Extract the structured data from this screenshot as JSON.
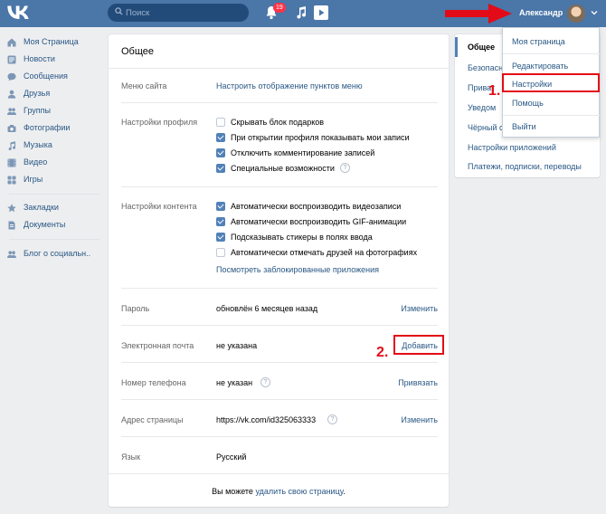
{
  "header": {
    "logo": "VK",
    "search_placeholder": "Поиск",
    "notification_count": "19",
    "user_name": "Александр"
  },
  "sidebar": {
    "items": [
      {
        "label": "Моя Страница",
        "icon": "home-icon"
      },
      {
        "label": "Новости",
        "icon": "news-icon"
      },
      {
        "label": "Сообщения",
        "icon": "messages-icon"
      },
      {
        "label": "Друзья",
        "icon": "friend-icon"
      },
      {
        "label": "Группы",
        "icon": "groups-icon"
      },
      {
        "label": "Фотографии",
        "icon": "camera-icon"
      },
      {
        "label": "Музыка",
        "icon": "music-icon"
      },
      {
        "label": "Видео",
        "icon": "video-icon"
      },
      {
        "label": "Игры",
        "icon": "games-icon"
      },
      {
        "label": "Закладки",
        "icon": "star-icon"
      },
      {
        "label": "Документы",
        "icon": "document-icon"
      },
      {
        "label": "Блог о социальн..",
        "icon": "blog-icon"
      }
    ]
  },
  "settings": {
    "title": "Общее",
    "site_menu": {
      "label": "Меню сайта",
      "link": "Настроить отображение пунктов меню"
    },
    "profile": {
      "label": "Настройки профиля",
      "options": [
        {
          "text": "Скрывать блок подарков",
          "checked": false
        },
        {
          "text": "При открытии профиля показывать мои записи",
          "checked": true
        },
        {
          "text": "Отключить комментирование записей",
          "checked": true
        },
        {
          "text": "Специальные возможности",
          "checked": true
        }
      ]
    },
    "content": {
      "label": "Настройки контента",
      "options": [
        {
          "text": "Автоматически воспроизводить видеозаписи",
          "checked": true
        },
        {
          "text": "Автоматически воспроизводить GIF-анимации",
          "checked": true
        },
        {
          "text": "Подсказывать стикеры в полях ввода",
          "checked": true
        },
        {
          "text": "Автоматически отмечать друзей на фотографиях",
          "checked": false
        }
      ],
      "blocked_link": "Посмотреть заблокированные приложения"
    },
    "password": {
      "label": "Пароль",
      "value": "обновлён 6 месяцев назад",
      "action": "Изменить"
    },
    "email": {
      "label": "Электронная почта",
      "value": "не указана",
      "action": "Добавить"
    },
    "phone": {
      "label": "Номер телефона",
      "value": "не указан",
      "action": "Привязать"
    },
    "address": {
      "label": "Адрес страницы",
      "value": "https://vk.com/id325063333",
      "action": "Изменить"
    },
    "language": {
      "label": "Язык",
      "value": "Русский"
    },
    "footer": {
      "prefix": "Вы можете",
      "link": "удалить свою страницу",
      "suffix": "."
    }
  },
  "right_nav": {
    "items": [
      "Общее",
      "Безопасн",
      "Приват",
      "Уведом",
      "Чёрный с",
      "Настройки приложений",
      "Платежи, подписки, переводы"
    ]
  },
  "dropdown": {
    "items": [
      "Моя страница",
      "Редактировать",
      "Настройки",
      "Помощь",
      "Выйти"
    ]
  },
  "annotations": {
    "step1": "1.",
    "step2": "2.",
    "color": "#e30b17"
  },
  "colors": {
    "header": "#4a76a8",
    "link": "#2a5885",
    "checkbox": "#5181b8",
    "background": "#edeef0"
  }
}
